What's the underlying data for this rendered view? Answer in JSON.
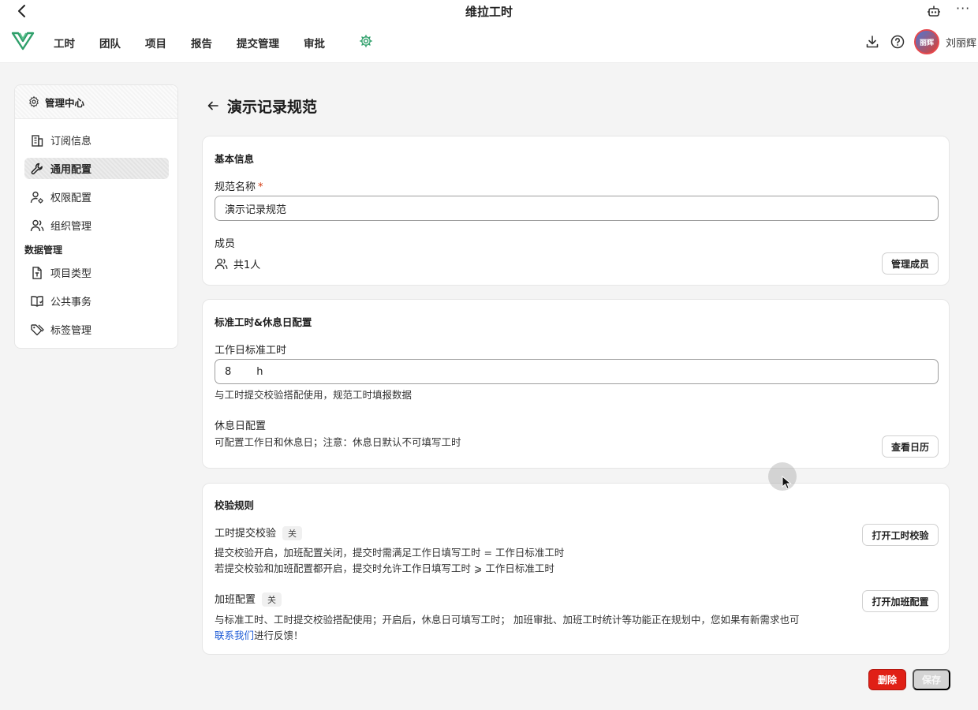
{
  "window": {
    "title": "维拉工时"
  },
  "nav": {
    "items": [
      "工时",
      "团队",
      "项目",
      "报告",
      "提交管理",
      "审批"
    ],
    "avatar_text": "丽辉",
    "username": "刘丽辉"
  },
  "sidebar": {
    "header": "管理中心",
    "items": [
      {
        "label": "订阅信息",
        "icon": "building-icon"
      },
      {
        "label": "通用配置",
        "icon": "wrench-icon",
        "active": true
      },
      {
        "label": "权限配置",
        "icon": "user-gear-icon"
      },
      {
        "label": "组织管理",
        "icon": "users-icon"
      }
    ],
    "group_label": "数据管理",
    "group_items": [
      {
        "label": "项目类型",
        "icon": "file-type-icon"
      },
      {
        "label": "公共事务",
        "icon": "book-icon"
      },
      {
        "label": "标签管理",
        "icon": "tag-icon"
      }
    ]
  },
  "page": {
    "title": "演示记录规范"
  },
  "basic": {
    "title": "基本信息",
    "name_label": "规范名称",
    "required_mark": "*",
    "name_value": "演示记录规范",
    "members_label": "成员",
    "members_count": "共1人",
    "manage_button": "管理成员"
  },
  "standard": {
    "title": "标准工时&休息日配置",
    "hours_label": "工作日标准工时",
    "hours_value": "8",
    "hours_unit": "h",
    "hours_desc": "与工时提交校验搭配使用，规范工时填报数据",
    "rest_label": "休息日配置",
    "rest_desc": "可配置工作日和休息日；注意：休息日默认不可填写工时",
    "calendar_button": "查看日历"
  },
  "rules": {
    "title": "校验规则",
    "submit_label": "工时提交校验",
    "submit_state": "关",
    "submit_desc_1": "提交校验开启，加班配置关闭，提交时需满足工作日填写工时 = 工作日标准工时",
    "submit_desc_2": "若提交校验和加班配置都开启，提交时允许工作日填写工时 ⩾ 工作日标准工时",
    "submit_button": "打开工时校验",
    "overtime_label": "加班配置",
    "overtime_state": "关",
    "overtime_desc_1": "与标准工时、工时提交校验搭配使用；开启后，休息日可填写工时； 加班审批、加班工时统计等功能正在规划中，您如果有新需求也可",
    "overtime_link": "联系我们",
    "overtime_desc_2": "进行反馈！",
    "overtime_button": "打开加班配置"
  },
  "footer": {
    "delete": "删除",
    "save": "保存"
  },
  "colors": {
    "accent": "#2e9f6a",
    "danger": "#e02016",
    "link": "#1d5bd6"
  }
}
